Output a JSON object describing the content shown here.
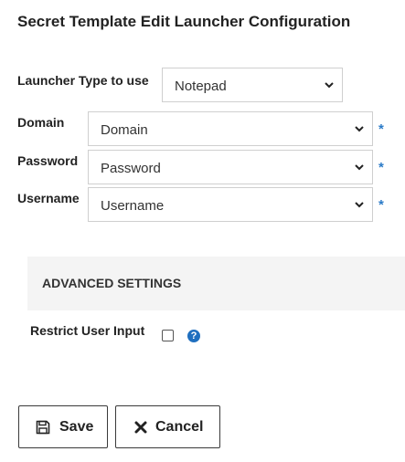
{
  "page": {
    "title": "Secret Template Edit Launcher Configuration"
  },
  "form": {
    "launcher_type": {
      "label": "Launcher Type to use",
      "value": "Notepad"
    },
    "domain": {
      "label": "Domain",
      "value": "Domain",
      "required_mark": "*"
    },
    "password": {
      "label": "Password",
      "value": "Password",
      "required_mark": "*"
    },
    "username": {
      "label": "Username",
      "value": "Username",
      "required_mark": "*"
    }
  },
  "advanced": {
    "title": "ADVANCED SETTINGS",
    "restrict_user_input": {
      "label": "Restrict User Input",
      "checked": false,
      "help_icon": "?"
    }
  },
  "buttons": {
    "save": {
      "label": "Save",
      "icon": "save-icon"
    },
    "cancel": {
      "label": "Cancel",
      "icon": "close-icon"
    }
  },
  "colors": {
    "required": "#2b7bc8",
    "help_icon": "#1f6fbf",
    "advanced_bg": "#f4f4f4"
  }
}
